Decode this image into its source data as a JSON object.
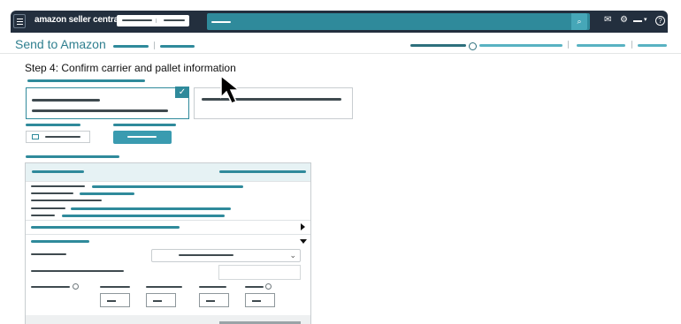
{
  "header": {
    "logo_text": "amazon seller central",
    "search_icon": "search-icon",
    "icons": [
      "mail-icon",
      "gear-icon",
      "help-icon"
    ]
  },
  "page": {
    "title": "Send to Amazon",
    "step_heading": "Step 4: Confirm carrier and pallet information"
  },
  "icons": {
    "menu": "hamburger-menu-icon",
    "check": "checkmark-icon",
    "calendar": "calendar-icon",
    "expand": "triangle-right-icon",
    "collapse": "triangle-down-icon",
    "dropdown": "chevron-down-icon",
    "cursor": "mouse-pointer-icon"
  },
  "colors": {
    "nav_bg": "#232f3e",
    "accent_teal": "#2f8a9b",
    "title_teal": "#2f7f8f",
    "panel_header_bg": "#e6f2f4"
  },
  "progress": {
    "current_step": 2,
    "total_steps": 4
  }
}
